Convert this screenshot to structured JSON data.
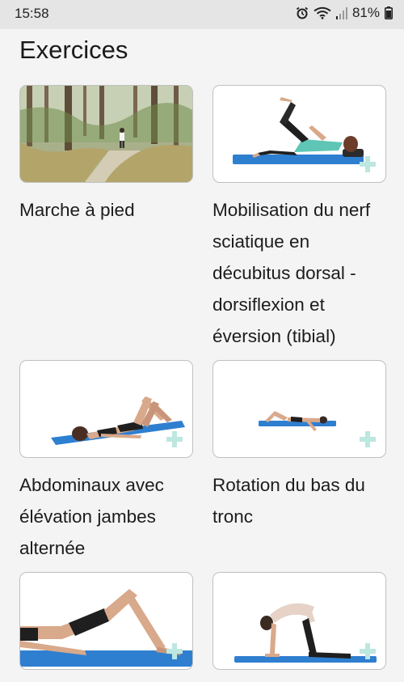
{
  "status_bar": {
    "time": "15:58",
    "battery": "81%",
    "icons": [
      "alarm-icon",
      "wifi-icon",
      "signal-icon",
      "battery-icon"
    ]
  },
  "page": {
    "title": "Exercices"
  },
  "exercises": [
    {
      "title": "Marche à pied",
      "image": "forest-path-walking"
    },
    {
      "title": "Mobilisation du nerf sciatique en décubitus dorsal - dorsiflexion et éversion (tibial)",
      "image": "supine-leg-raise-on-mat"
    },
    {
      "title": "Abdominaux avec élévation jambes alternée",
      "image": "supine-knees-bent-on-mat"
    },
    {
      "title": "Rotation du bas du tronc",
      "image": "lower-trunk-rotation-on-mat"
    },
    {
      "title": "",
      "image": "glute-bridge-on-mat"
    },
    {
      "title": "",
      "image": "cat-cow-on-mat"
    }
  ],
  "colors": {
    "background": "#f3f4f3",
    "status_bar": "#e4e5e4",
    "mat_blue": "#2f7fd0",
    "plus_accent": "#bde7e1"
  }
}
